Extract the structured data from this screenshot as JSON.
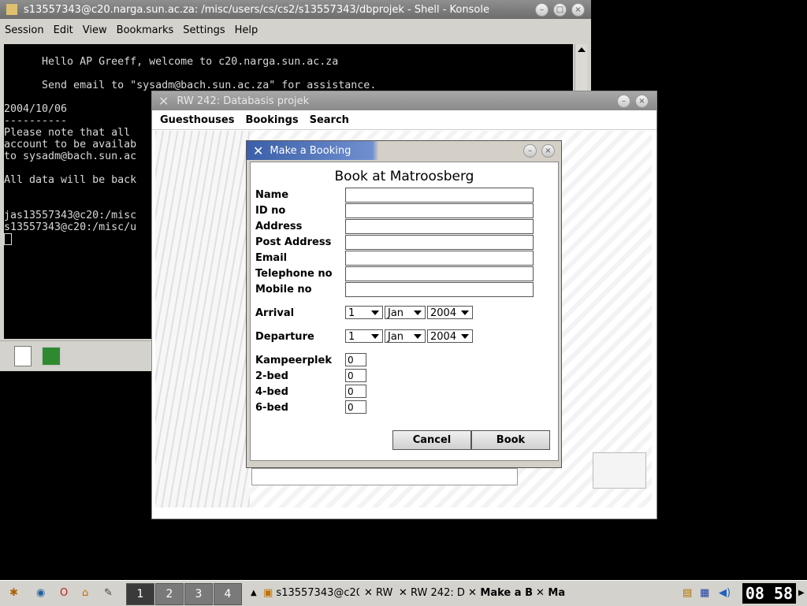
{
  "konsole": {
    "title": "s13557343@c20.narga.sun.ac.za: /misc/users/cs/cs2/s13557343/dbprojek - Shell - Konsole",
    "menu": [
      "Session",
      "Edit",
      "View",
      "Bookmarks",
      "Settings",
      "Help"
    ],
    "terminal_lines": [
      "",
      "      Hello AP Greeff, welcome to c20.narga.sun.ac.za",
      "",
      "      Send email to \"sysadm@bach.sun.ac.za\" for assistance.",
      "",
      "2004/10/06",
      "----------",
      "Please note that all",
      "account to be availab",
      "to sysadm@bach.sun.ac",
      "",
      "All data will be back",
      "",
      "",
      "jas13557343@c20:/misc",
      "s13557343@c20:/misc/u"
    ]
  },
  "rw_window": {
    "title": "RW 242: Databasis projek",
    "menu": [
      "Guesthouses",
      "Bookings",
      "Search"
    ]
  },
  "dialog": {
    "title": "Make a Booking",
    "heading": "Book at Matroosberg",
    "fields": [
      {
        "label": "Name",
        "value": ""
      },
      {
        "label": "ID no",
        "value": ""
      },
      {
        "label": "Address",
        "value": ""
      },
      {
        "label": "Post Address",
        "value": ""
      },
      {
        "label": "Email",
        "value": ""
      },
      {
        "label": "Telephone no",
        "value": ""
      },
      {
        "label": "Mobile no",
        "value": ""
      }
    ],
    "arrival": {
      "label": "Arrival",
      "day": "1",
      "month": "Jan",
      "year": "2004"
    },
    "departure": {
      "label": "Departure",
      "day": "1",
      "month": "Jan",
      "year": "2004"
    },
    "counts": [
      {
        "label": "Kampeerplek",
        "value": "0"
      },
      {
        "label": "2-bed",
        "value": "0"
      },
      {
        "label": "4-bed",
        "value": "0"
      },
      {
        "label": "6-bed",
        "value": "0"
      }
    ],
    "cancel_label": "Cancel",
    "book_label": "Book"
  },
  "taskbar": {
    "desktops": [
      "1",
      "2",
      "3",
      "4"
    ],
    "tasks": [
      "s13557343@c20",
      "RW",
      "RW 242: D",
      "Make a B",
      "Ma"
    ],
    "clock": "08 58"
  }
}
